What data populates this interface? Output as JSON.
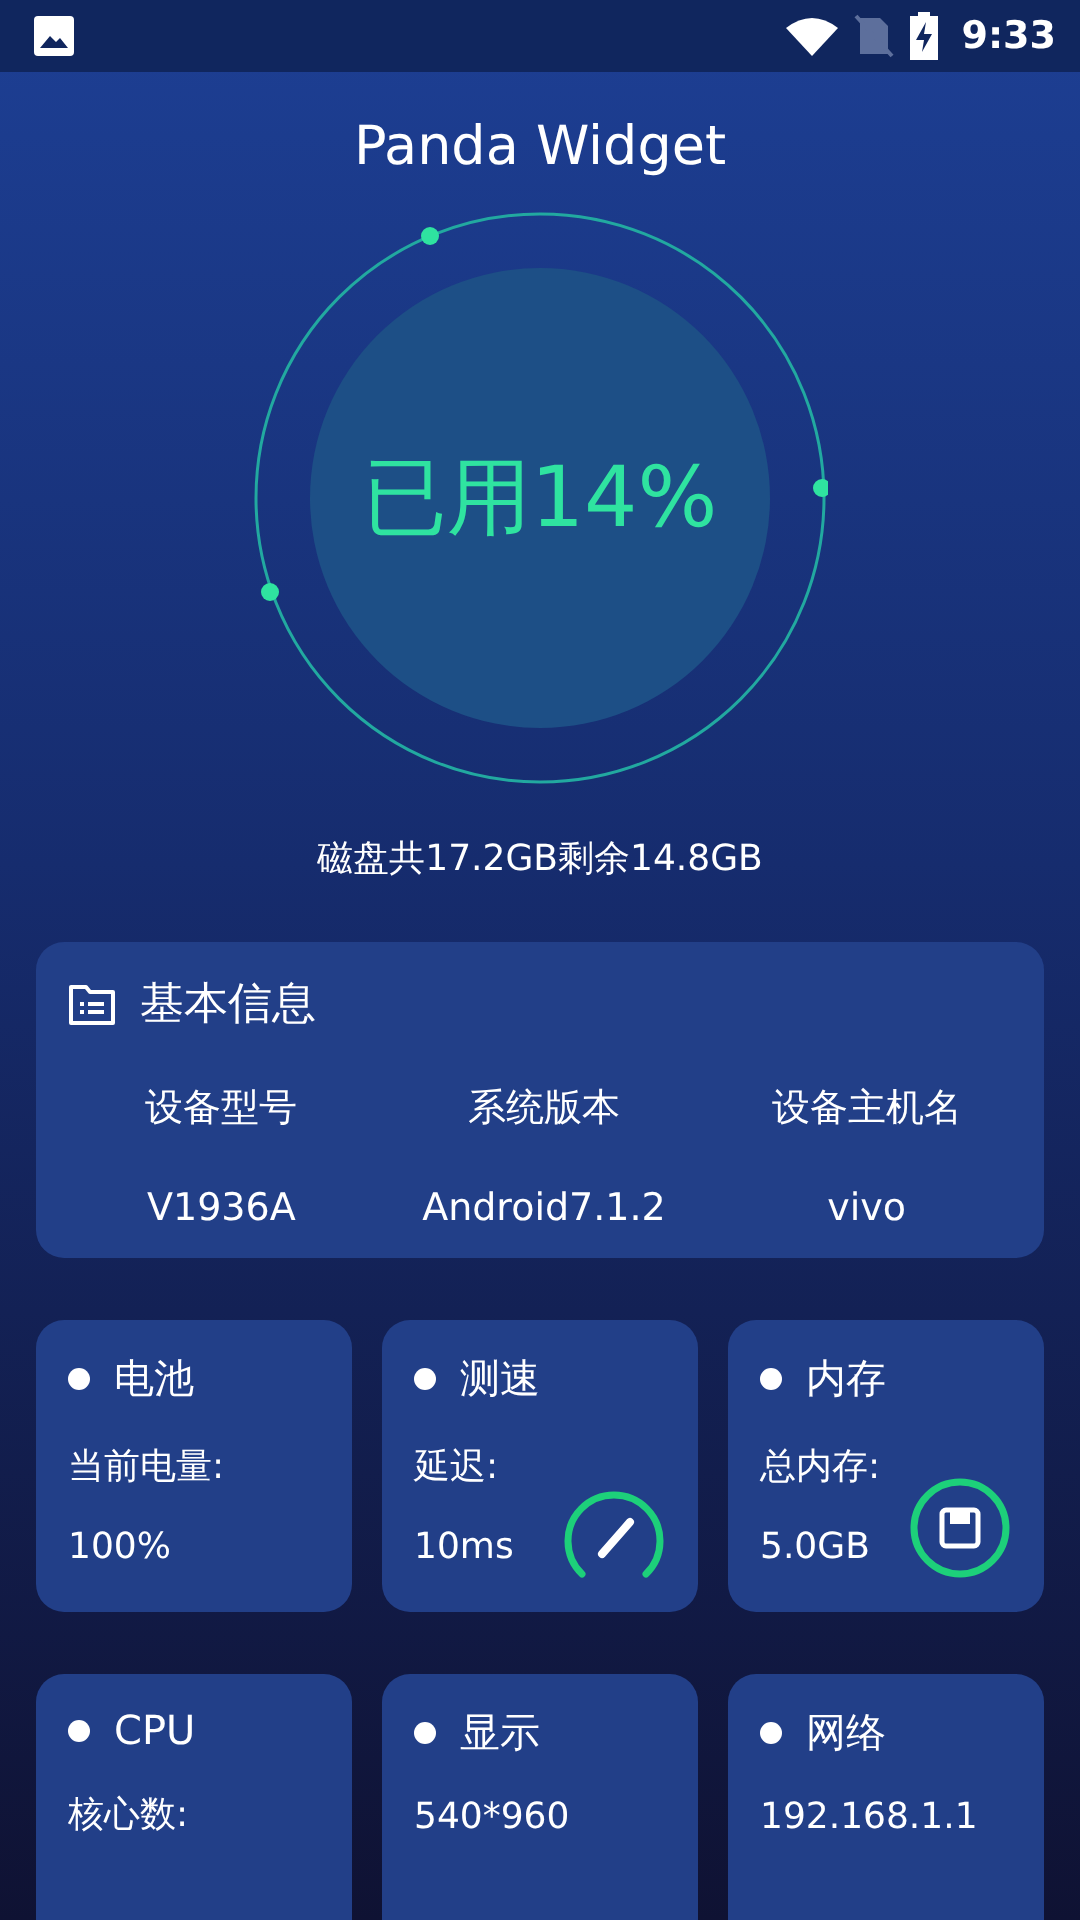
{
  "status_bar": {
    "time": "9:33"
  },
  "title": "Panda Widget",
  "usage": {
    "label": "已用14%",
    "disk": "磁盘共17.2GB剩余14.8GB"
  },
  "basic_info": {
    "title": "基本信息",
    "columns": [
      {
        "label": "设备型号",
        "value": "V1936A"
      },
      {
        "label": "系统版本",
        "value": "Android7.1.2"
      },
      {
        "label": "设备主机名",
        "value": "vivo"
      }
    ]
  },
  "cards": [
    {
      "kind": "plain",
      "title": "电池",
      "lines": [
        "当前电量:",
        "100%"
      ]
    },
    {
      "kind": "speed",
      "title": "测速",
      "lines": [
        "延迟:",
        "10ms"
      ]
    },
    {
      "kind": "memory",
      "title": "内存",
      "lines": [
        "总内存:",
        "5.0GB"
      ]
    },
    {
      "kind": "plain",
      "title": "CPU",
      "lines": [
        "核心数:"
      ]
    },
    {
      "kind": "plain",
      "title": "显示",
      "lines": [
        "540*960"
      ]
    },
    {
      "kind": "plain",
      "title": "网络",
      "lines": [
        "192.168.1.1"
      ]
    }
  ]
}
